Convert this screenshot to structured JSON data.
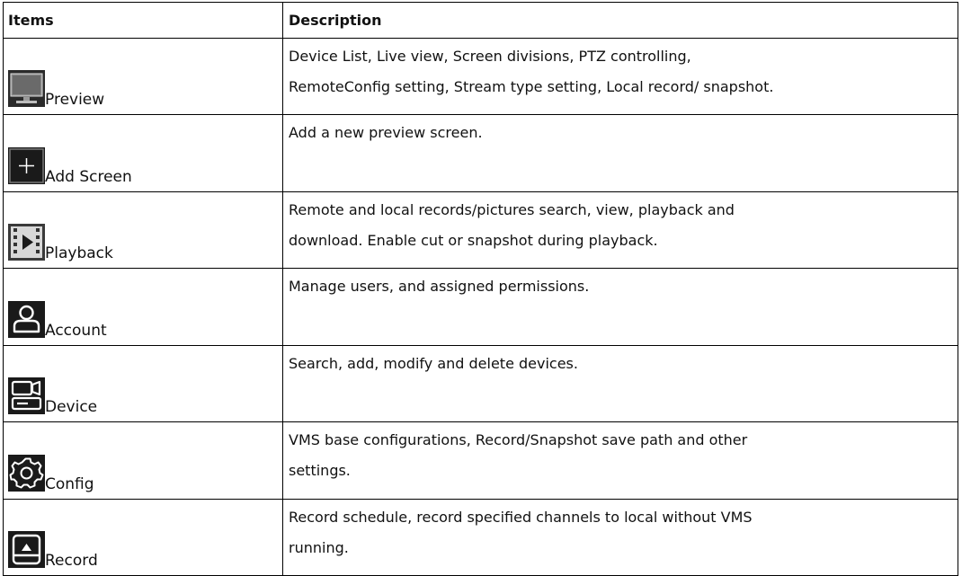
{
  "table": {
    "headers": {
      "items": "Items",
      "description": "Description"
    },
    "rows": [
      {
        "label": "Preview",
        "icon": "monitor-icon",
        "lines": [
          "Device List, Live view, Screen divisions, PTZ controlling,",
          "RemoteConfig setting, Stream type setting, Local record/ snapshot."
        ]
      },
      {
        "label": "Add Screen",
        "icon": "add-screen-icon",
        "lines": [
          "Add a new preview screen."
        ]
      },
      {
        "label": "Playback",
        "icon": "film-play-icon",
        "lines": [
          "Remote and local records/pictures search, view, playback and",
          "download. Enable cut or snapshot during playback."
        ]
      },
      {
        "label": "Account",
        "icon": "user-icon",
        "lines": [
          "Manage users, and assigned permissions."
        ]
      },
      {
        "label": "Device",
        "icon": "camera-device-icon",
        "lines": [
          "Search, add, modify and delete devices."
        ]
      },
      {
        "label": "Config",
        "icon": "gear-icon",
        "lines": [
          "VMS base configurations, Record/Snapshot save path and other",
          "settings."
        ]
      },
      {
        "label": "Record",
        "icon": "record-drive-icon",
        "lines": [
          "Record schedule, record specified channels to local without VMS",
          "running."
        ]
      }
    ]
  },
  "colors": {
    "icon_bg": "#1a1a1a",
    "icon_fg": "#ffffff",
    "border": "#000000"
  }
}
